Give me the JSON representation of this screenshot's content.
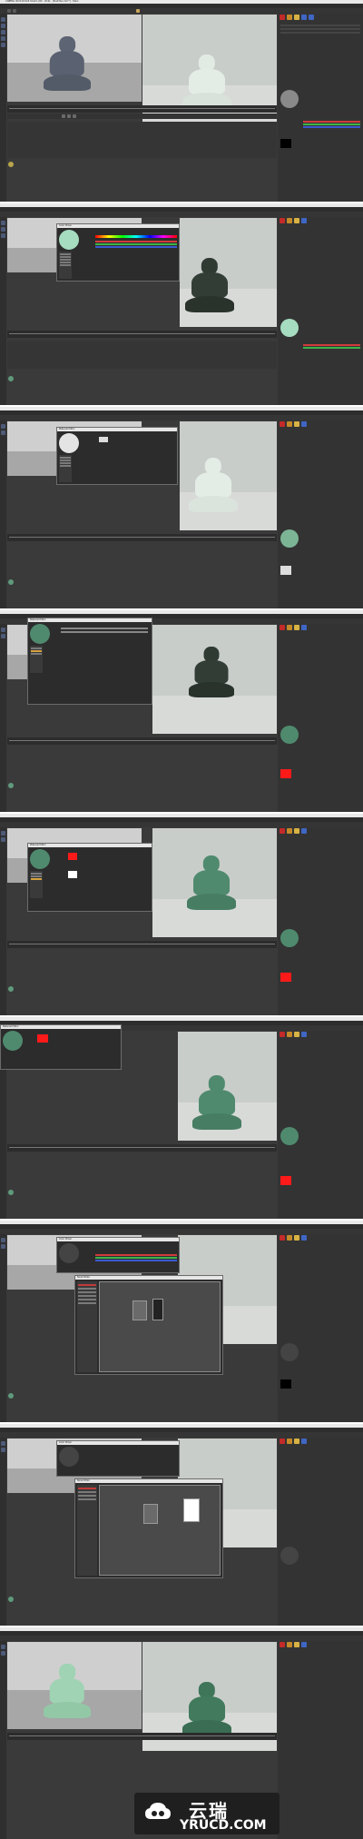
{
  "app": {
    "window_title": "CINEMA 4D R19.024 Studio (RC - R19) - [Buddha.c4d *] - Main",
    "frame_label": "0 F"
  },
  "colors": {
    "ui_dark": "#3a3a3a",
    "viewport_light": "#c9cdca",
    "jade_green": "#4f8a6e",
    "pale_jade": "#9fd3b3",
    "material_red": "#ff1a1a",
    "gray_statue": "#5d6473",
    "white_statue": "#e4ece6",
    "dark_green_statue": "#2f3a33"
  },
  "panels": {
    "object_manager_title": "Objects",
    "attributes_title": "Attributes",
    "material_manager_title": "Material"
  },
  "dialogs": {
    "color_picker_title": "Color Picker",
    "material_editor_title": "Material Editor",
    "node_editor_title": "Node Editor"
  },
  "watermark": {
    "brand_cn": "云瑞",
    "brand_url": "YRUCD.COM",
    "logo_icon": "cloud-icon"
  }
}
